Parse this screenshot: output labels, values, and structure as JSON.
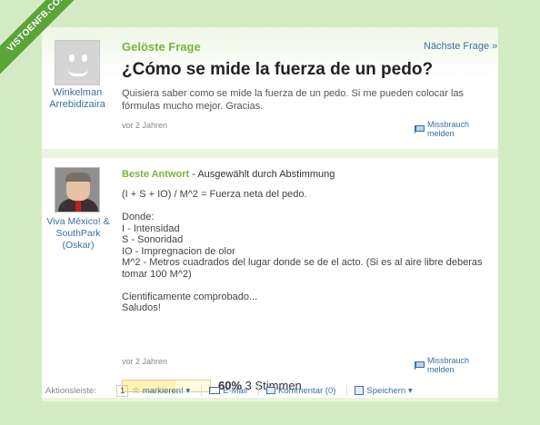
{
  "watermark": "VISTOENFB.COM",
  "question": {
    "status": "Gelöste Frage",
    "next_link": "Nächste Frage »",
    "title": "¿Cómo se mide la fuerza de un pedo?",
    "body": "Quisiera saber como se mide la fuerza de un pedo. Si me pueden colocar las fórmulas mucho mejor. Gracias.",
    "asker": "Winkelman Arrebidizaira",
    "time": "vor 2 Jahren",
    "report": "Missbrauch melden"
  },
  "answer": {
    "best_label": "Beste Antwort",
    "chosen_by": " - Ausgewählt durch Abstimmung",
    "author": "Viva México! & SouthPark (Oskar)",
    "body": "(I + S + IO) / M^2 = Fuerza neta del pedo.\n\nDonde:\nI - Intensidad\nS - Sonoridad\nIO - Impregnacion de olor\nM^2 - Metros cuadrados del lugar donde se de el acto. (Si es al aire libre deberas tomar 100 M^2)\n\nCientificamente comprobado...\nSaludos!",
    "time": "vor 2 Jahren",
    "report": "Missbrauch melden",
    "rating_percent": "60%",
    "rating_fraction": 0.6,
    "votes": "3 Stimmen"
  },
  "actionbar": {
    "label": "Aktionsleiste:",
    "count": "1",
    "mark": "markieren! ▾",
    "email": "E-Mail",
    "comment": "Kommentar (0)",
    "save": "Speichern ▾"
  },
  "colors": {
    "background": "#d3ecc3",
    "accent_green": "#7cb342",
    "link_blue": "#3b6ea5"
  }
}
